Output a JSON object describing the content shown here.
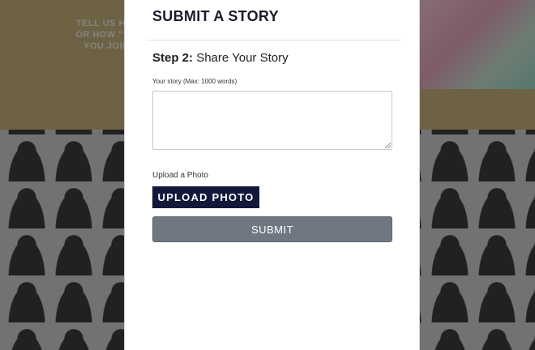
{
  "background_page": {
    "hero_lines": [
      "TELL US HOW Y",
      "OR HOW \"THE S",
      "YOU JOIN #T"
    ]
  },
  "modal": {
    "title": "SUBMIT A STORY",
    "step": {
      "label": "Step 2:",
      "text": "Share Your Story"
    },
    "story_field": {
      "label": "Your story (Max: 1000 words)",
      "value": "",
      "placeholder": ""
    },
    "photo": {
      "label": "Upload a Photo",
      "button_label": "UPLOAD PHOTO"
    },
    "submit_label": "SUBMIT"
  },
  "colors": {
    "upload_button": "#11183a",
    "submit_button": "#6f7882",
    "hero_background": "#c9b27e"
  }
}
